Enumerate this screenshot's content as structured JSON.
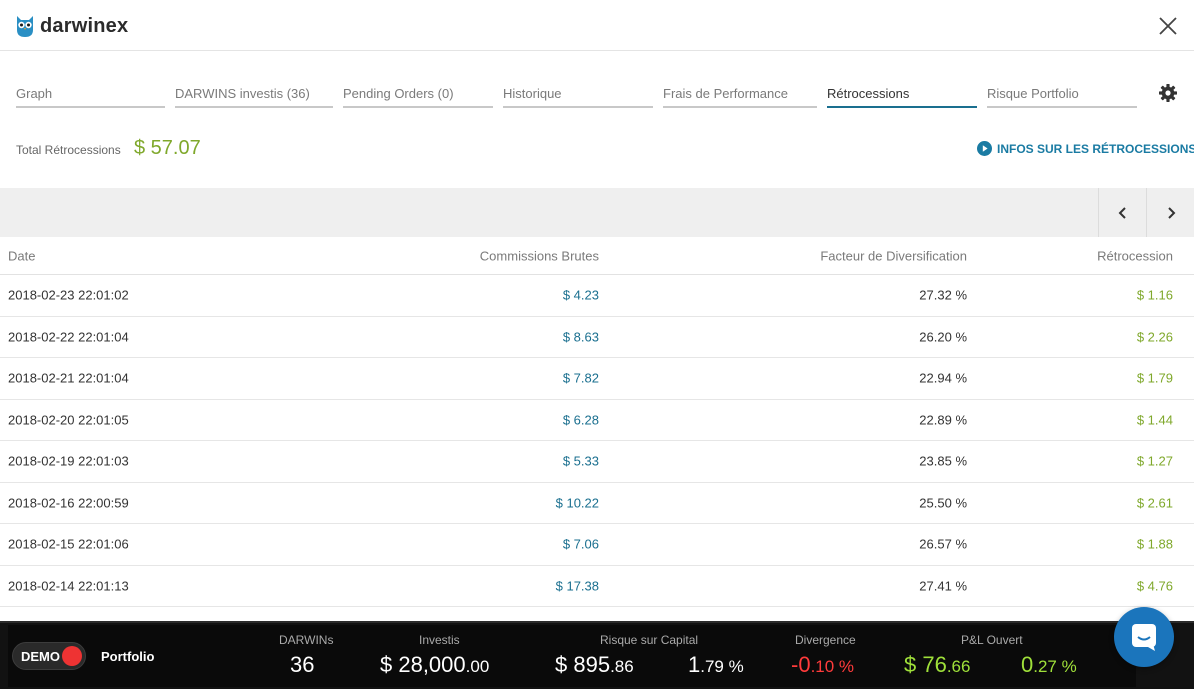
{
  "app": {
    "brand": "darwinex"
  },
  "tabs": [
    {
      "label": "Graph"
    },
    {
      "label": "DARWINS investis (36)"
    },
    {
      "label": "Pending Orders (0)"
    },
    {
      "label": "Historique"
    },
    {
      "label": "Frais de Performance"
    },
    {
      "label": "Rétrocessions"
    },
    {
      "label": "Risque Portfolio"
    }
  ],
  "total": {
    "label": "Total Rétrocessions",
    "value": "$ 57.07"
  },
  "infos_link": "INFOS SUR LES RÉTROCESSIONS",
  "table": {
    "headers": {
      "date": "Date",
      "commissions": "Commissions Brutes",
      "factor": "Facteur de Diversification",
      "retro": "Rétrocession"
    },
    "rows": [
      {
        "date": "2018-02-23 22:01:02",
        "commissions": "$ 4.23",
        "factor": "27.32 %",
        "retro": "$ 1.16"
      },
      {
        "date": "2018-02-22 22:01:04",
        "commissions": "$ 8.63",
        "factor": "26.20 %",
        "retro": "$ 2.26"
      },
      {
        "date": "2018-02-21 22:01:04",
        "commissions": "$ 7.82",
        "factor": "22.94 %",
        "retro": "$ 1.79"
      },
      {
        "date": "2018-02-20 22:01:05",
        "commissions": "$ 6.28",
        "factor": "22.89 %",
        "retro": "$ 1.44"
      },
      {
        "date": "2018-02-19 22:01:03",
        "commissions": "$ 5.33",
        "factor": "23.85 %",
        "retro": "$ 1.27"
      },
      {
        "date": "2018-02-16 22:00:59",
        "commissions": "$ 10.22",
        "factor": "25.50 %",
        "retro": "$ 2.61"
      },
      {
        "date": "2018-02-15 22:01:06",
        "commissions": "$ 7.06",
        "factor": "26.57 %",
        "retro": "$ 1.88"
      },
      {
        "date": "2018-02-14 22:01:13",
        "commissions": "$ 17.38",
        "factor": "27.41 %",
        "retro": "$ 4.76"
      }
    ]
  },
  "footer": {
    "demo": "DEMO",
    "portfolio": "Portfolio",
    "darwins": {
      "label": "DARWINs",
      "value": "36"
    },
    "investis": {
      "label": "Investis",
      "main": "$ 28,000",
      "dec": ".00"
    },
    "risque": {
      "label": "Risque sur Capital",
      "main": "$ 895",
      "dec": ".86",
      "pct_main": "1",
      "pct_dec": ".79 %"
    },
    "divergence": {
      "label": "Divergence",
      "main": "-0",
      "dec": ".10 %"
    },
    "pl": {
      "label": "P&L Ouvert",
      "main": "$ 76",
      "dec": ".66",
      "pct_main": "0",
      "pct_dec": ".27 %"
    }
  },
  "colors": {
    "accent": "#1a6f8f",
    "positive": "#7fa82b",
    "negative": "#ff3b3b",
    "chat": "#1b75bc"
  }
}
